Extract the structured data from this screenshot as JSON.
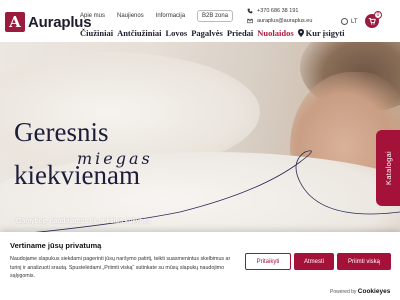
{
  "logo": {
    "mark": "A",
    "text": "Auraplus"
  },
  "toplinks": {
    "about": "Apie mus",
    "news": "Naujienos",
    "info": "Informacija",
    "b2b": "B2B zona"
  },
  "contacts": {
    "phone": "+370 686 38 191",
    "email": "auraplus@auraplus.eu"
  },
  "lang": {
    "code": "LT"
  },
  "cart": {
    "count": "0"
  },
  "nav": {
    "items": [
      "Čiužiniai",
      "Antčiužiniai",
      "Lovos",
      "Pagalvės",
      "Priedai"
    ],
    "sale": "Nuolaidos",
    "where": "Kur įsigyti"
  },
  "hero": {
    "line1": "Geresnis",
    "line2": "miegas",
    "line3": "kiekvienam",
    "subtitle": "Gamyboje naudojamos tik aukštos kokybės"
  },
  "side_tab": {
    "label": "Katalogai"
  },
  "cookie": {
    "title": "Vertiname jūsų privatumą",
    "text": "Naudojame slapukus siekdami pagerinti jūsų naršymo patirtį, teikti suasmenintus skelbimus ar turinį ir analizuoti srautą. Spustelėdami „Priimti viską“ sutinkate su mūsų slapukų naudojimo sąlygomis.",
    "customize": "Pritaikyti",
    "reject": "Atmesti",
    "accept": "Priimti viską",
    "powered_label": "Powered by",
    "powered_brand": "Cookieyes"
  },
  "colors": {
    "brand": "#a4123a",
    "heading": "#1d1d3a"
  }
}
